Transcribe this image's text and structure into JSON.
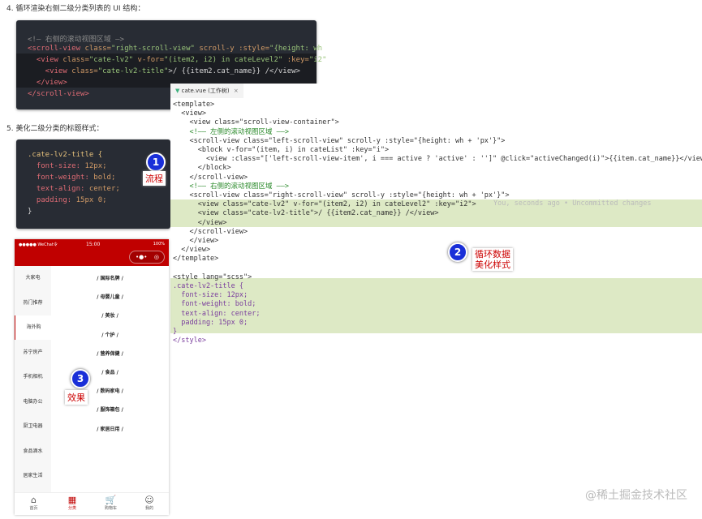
{
  "steps": {
    "step4": "4. 循环渲染右侧二级分类列表的 UI 结构：",
    "step5": "5. 美化二级分类的标题样式："
  },
  "snippet1": {
    "l1": "<!— 右侧的滚动视图区域 —>",
    "l2a": "<scroll-view ",
    "l2b": "class=",
    "l2c": "\"right-scroll-view\"",
    "l2d": " scroll-y :style=",
    "l2e": "\"{height: wh",
    "l3a": "  <view ",
    "l3b": "class=",
    "l3c": "\"cate-lv2\"",
    "l3d": " v-for=",
    "l3e": "\"(item2, i2) in cateLevel2\"",
    "l3f": " :key=",
    "l3g": "\"i2\"",
    "l4a": "    <view ",
    "l4b": "class=",
    "l4c": "\"cate-lv2-title\"",
    "l4d": ">/ {{item2.cat_name}} /</view>",
    "l5": "  </view>",
    "l6": "</scroll-view>"
  },
  "snippet2": {
    "l1": ".cate-lv2-title {",
    "l2a": "  font-size:",
    "l2b": " 12px;",
    "l3a": "  font-weight:",
    "l3b": " bold;",
    "l4a": "  text-align:",
    "l4b": " center;",
    "l5a": "  padding:",
    "l5b": " 15px 0;",
    "l6": "}"
  },
  "annotations": {
    "b1": "1",
    "n1": "流程",
    "b2": "2",
    "n2a": "循环数据",
    "n2b": "美化样式",
    "b3": "3",
    "n3": "效果"
  },
  "editor": {
    "tab": "cate.vue (工作树)",
    "close": "×",
    "lines": [
      "<template>",
      "  <view>",
      "    <view class=\"scroll-view-container\">",
      "    <!—— 左侧的滚动视图区域 ——>",
      "    <scroll-view class=\"left-scroll-view\" scroll-y :style=\"{height: wh + 'px'}\">",
      "      <block v-for=\"(item, i) in cateList\" :key=\"i\">",
      "        <view :class=\"['left-scroll-view-item', i === active ? 'active' : '']\" @click=\"activeChanged(i)\">{{item.cat_name}}</view>",
      "      </block>",
      "    </scroll-view>",
      "    <!—— 右侧的滚动视图区域 ——>",
      "    <scroll-view class=\"right-scroll-view\" scroll-y :style=\"{height: wh + 'px'}\">",
      "      <view class=\"cate-lv2\" v-for=\"(item2, i2) in cateLevel2\" :key=\"i2\">",
      "      <view class=\"cate-lv2-title\">/ {{item2.cat_name}} /</view>",
      "      </view>",
      "    </scroll-view>",
      "    </view>",
      "  </view>",
      "</template>",
      "",
      "<style lang=\"scss\">",
      ".cate-lv2-title {",
      "  font-size: 12px;",
      "  font-weight: bold;",
      "  text-align: center;",
      "  padding: 15px 0;",
      "}",
      "</style>"
    ],
    "blame": "You, seconds ago • Uncommitted changes"
  },
  "phone": {
    "status": {
      "carrier": "●●●●● WeChat令",
      "time": "15:00",
      "battery": "100%"
    },
    "capsule": {
      "more": "•●•",
      "close": "◎"
    },
    "left": [
      "大家电",
      "热门推荐",
      "海外购",
      "苏宁房产",
      "手机相机",
      "电脑办公",
      "厨卫电器",
      "食品酒水",
      "居家生活"
    ],
    "active_index": 2,
    "right": [
      "/ 国际名牌 /",
      "/ 母婴儿童 /",
      "/ 美妆 /",
      "/ 个护 /",
      "/ 营养保健 /",
      "/ 食品 /",
      "/ 数码家电 /",
      "/ 服饰箱包 /",
      "/ 家居日用 /"
    ],
    "tabs": [
      "首页",
      "分类",
      "购物车",
      "我的"
    ],
    "active_tab": 1
  },
  "watermark": "@稀土掘金技术社区",
  "colors": {
    "brand": "#c00000",
    "badge": "#1a2fd8",
    "highlight": "#dde9c5"
  }
}
